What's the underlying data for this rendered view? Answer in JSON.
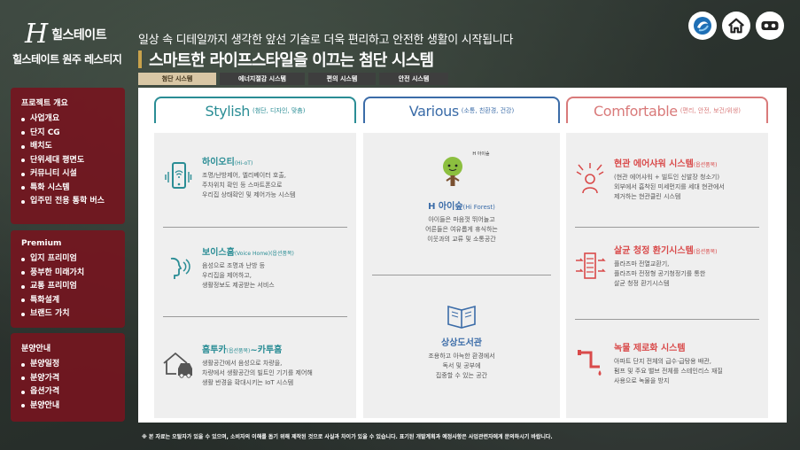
{
  "brand": {
    "logo_mark": "H",
    "logo_text": "힐스테이트",
    "site_title": "힐스테이트 원주 레스티지"
  },
  "header": {
    "tagline": "일상 속 디테일까지 생각한 앞선 기술로 더욱 편리하고 안전한 생활이 시작됩니다",
    "headline": "스마트한 라이프스타일을 이끄는 첨단 시스템"
  },
  "top_icons": [
    "logo-badge-icon",
    "home-icon",
    "vr-goggles-icon"
  ],
  "tabs": [
    {
      "label": "첨단 시스템",
      "active": true
    },
    {
      "label": "에너지절감 시스템",
      "active": false
    },
    {
      "label": "편의 시스템",
      "active": false
    },
    {
      "label": "안전 시스템",
      "active": false
    }
  ],
  "sidebar": {
    "group1": {
      "heading": "프로젝트 개요",
      "items": [
        "사업개요",
        "단지 CG",
        "배치도",
        "단위세대 평면도",
        "커뮤니티 시설",
        "특화 시스템",
        "입주민 전용 통학 버스"
      ]
    },
    "group2": {
      "heading": "Premium",
      "items": [
        "입지 프리미엄",
        "풍부한 미래가치",
        "교통 프리미엄",
        "특화설계",
        "브랜드 가치"
      ]
    },
    "group3": {
      "heading": "분양안내",
      "items": [
        "분양일정",
        "분양가격",
        "옵션가격",
        "분양안내"
      ]
    }
  },
  "columns": {
    "stylish": {
      "title": "Stylish",
      "sub": "(첨단, 디자인, 맞춤)",
      "items": [
        {
          "title": "하이오티",
          "title_sub": "(Hi-oT)",
          "desc": [
            "조명/난방제어, 엘리베이터 호출,",
            "주차위치 확인 등 스마트폰으로",
            "우리집 상태확인 및 제어가능 시스템"
          ]
        },
        {
          "title": "보이스홈",
          "title_sub": "(Voice Home)",
          "note": "(옵션품목)",
          "desc": [
            "음성으로 조명과 난방 등",
            "우리집을 제어하고,",
            "생활정보도 제공받는 서비스"
          ]
        },
        {
          "title": "홈투카",
          "note": "(옵션품목)",
          "title_tail": "~카투홈",
          "desc": [
            "생활공간에서 음성으로 차량을,",
            "차량에서 생활공간의 빌트인 기기를 제어해",
            "생활 반경을 확대시키는 IoT 시스템"
          ]
        }
      ]
    },
    "various": {
      "title": "Various",
      "sub": "(소통, 친환경, 건강)",
      "items": [
        {
          "title": "H 아이숲",
          "title_sub": "(Hi Forest)",
          "badge": "H 아이숲",
          "desc": [
            "아이들은 마음껏 뛰어놀고",
            "어른들은 여유롭게 휴식하는",
            "이웃과의 교류 및 소통공간"
          ]
        },
        {
          "title": "상상도서관",
          "desc": [
            "조용하고 아늑한 환경에서",
            "독서 및 공부에",
            "집중할 수 있는 공간"
          ]
        }
      ]
    },
    "comfortable": {
      "title": "Comfortable",
      "sub": "(편리, 안전, 보건/위생)",
      "items": [
        {
          "title": "현관 에어샤워 시스템",
          "note": "(옵션품목)",
          "desc": [
            "(현관 에어샤워 + 빌트인 신발장 청소기)",
            "외부에서 흡착된 미세먼지를 세대 현관에서",
            "제거하는 현관클린 시스템"
          ]
        },
        {
          "title": "살균 청정 환기시스템",
          "note": "(옵션품목)",
          "desc": [
            "플라즈마 전열교환기,",
            "플라즈마 전정형 공기청정기를 통한",
            "살균 청정 환기시스템"
          ]
        },
        {
          "title": "녹물 제로화 시스템",
          "desc": [
            "아파트 단지 전체의 급수·급탕용 배관,",
            "펌프 및 주요 밸브 전체를 스테인리스 재질",
            "사용으로 녹물을 방지"
          ]
        }
      ]
    }
  },
  "footer": "※ 본 자료는 오탈자가 있을 수 있으며, 소비자의 이해를 돕기 위해 제작된 것으로 사실과 차이가 있을 수 있습니다. 표기된 개발계획과 예정사항은 사업관련자에게 문의하시기 바랍니다."
}
